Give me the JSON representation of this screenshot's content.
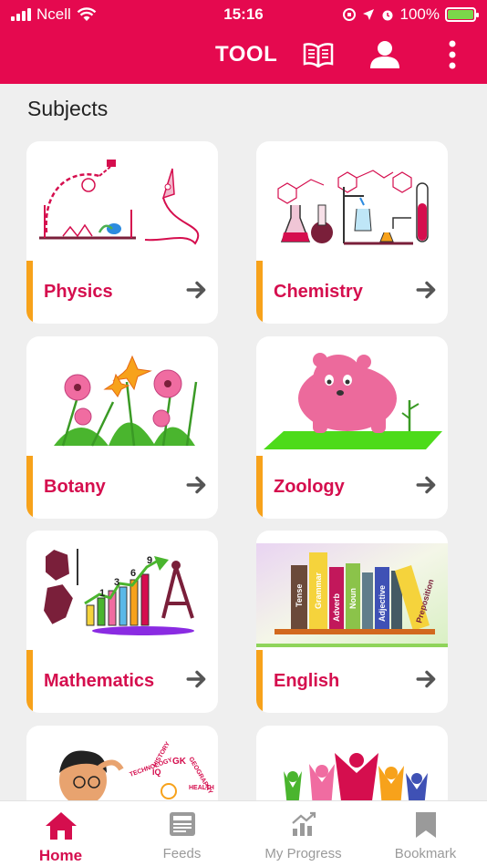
{
  "status_bar": {
    "carrier": "Ncell",
    "time": "15:16",
    "battery_percent": "100%",
    "battery_level": 1.0
  },
  "app_bar": {
    "title": "TOOL",
    "icons": [
      "book-icon",
      "user-icon",
      "more-vertical-icon"
    ]
  },
  "colors": {
    "primary": "#e5094f",
    "accent": "#f7a21b",
    "subject_text": "#d50e4e"
  },
  "section": {
    "title": "Subjects"
  },
  "subjects": [
    {
      "name": "Physics",
      "icon": "physics-illustration"
    },
    {
      "name": "Chemistry",
      "icon": "chemistry-illustration"
    },
    {
      "name": "Botany",
      "icon": "botany-illustration"
    },
    {
      "name": "Zoology",
      "icon": "zoology-illustration"
    },
    {
      "name": "Mathematics",
      "icon": "mathematics-illustration"
    },
    {
      "name": "English",
      "icon": "english-illustration"
    },
    {
      "name": "",
      "icon": "general-knowledge-illustration"
    },
    {
      "name": "",
      "icon": "people-illustration"
    }
  ],
  "math_chart_labels": [
    "1",
    "3",
    "6",
    "9"
  ],
  "english_book_labels": [
    "Tense",
    "Grammar",
    "Adverb",
    "Noun",
    "Adjective",
    "Preposition"
  ],
  "gk_words": [
    "HISTORY",
    "GK",
    "GEOGRAPHY",
    "TECHNOLOGY",
    "IQ",
    "HEALTH"
  ],
  "bottom_nav": {
    "items": [
      {
        "label": "Home",
        "icon": "home-icon",
        "active": true
      },
      {
        "label": "Feeds",
        "icon": "feeds-icon",
        "active": false
      },
      {
        "label": "My Progress",
        "icon": "progress-icon",
        "active": false
      },
      {
        "label": "Bookmark",
        "icon": "bookmark-icon",
        "active": false
      }
    ]
  }
}
